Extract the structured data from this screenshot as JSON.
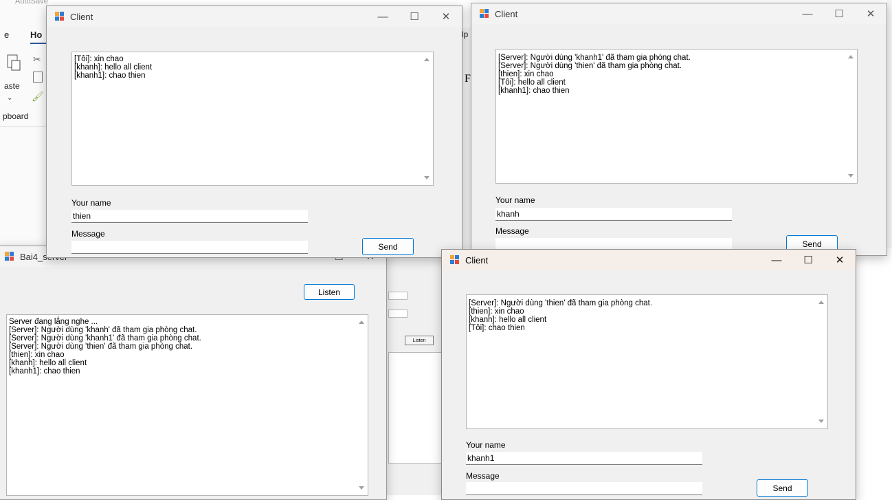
{
  "background_app": {
    "tab_file_partial": "e",
    "tab_home_partial": "Ho",
    "paste_label_partial": "aste",
    "clipboard_label_partial": "pboard",
    "help_partial": "lp",
    "autosave_partial": "AutoSave"
  },
  "bg_server2": {
    "listen_label": "Listen"
  },
  "client_thien": {
    "title": "Client",
    "messages": [
      "[Tôi]: xin chao",
      "[khanh]: hello all client",
      "[khanh1]: chao thien"
    ],
    "name_label": "Your name",
    "name_value": "thien",
    "message_label": "Message",
    "message_value": "",
    "send_label": "Send"
  },
  "client_khanh": {
    "title": "Client",
    "messages": [
      "[Server]: Người dùng 'khanh1' đã tham gia phòng chat.",
      "[Server]: Người dùng 'thien' đã tham gia phòng chat.",
      "[thien]: xin chao",
      "[Tôi]: hello all client",
      "[khanh1]: chao thien"
    ],
    "name_label": "Your name",
    "name_value": "khanh",
    "message_label": "Message",
    "message_value": "",
    "send_label": "Send"
  },
  "server": {
    "title": "Bai4_server",
    "listen_label": "Listen",
    "log": [
      "Server đang lắng nghe ...",
      "[Server]: Người dùng 'khanh' đã tham gia phòng chat.",
      "[Server]: Người dùng 'khanh1' đã tham gia phòng chat.",
      "[Server]: Người dùng 'thien' đã tham gia phòng chat.",
      "[thien]: xin chao",
      "[khanh]: hello all client",
      "[khanh1]: chao thien"
    ]
  },
  "client_khanh1": {
    "title": "Client",
    "messages": [
      "[Server]: Người dùng 'thien' đã tham gia phòng chat.",
      "[thien]: xin chao",
      "[khanh]: hello all client",
      "[Tôi]: chao thien"
    ],
    "name_label": "Your name",
    "name_value": "khanh1",
    "message_label": "Message",
    "message_value": "",
    "send_label": "Send"
  },
  "window_controls": {
    "minimize": "—",
    "maximize": "☐",
    "close": "✕"
  },
  "colors": {
    "accent": "#0078d4",
    "window_bg": "#f0f0f0",
    "active_title_bg": "#f6eee9"
  }
}
